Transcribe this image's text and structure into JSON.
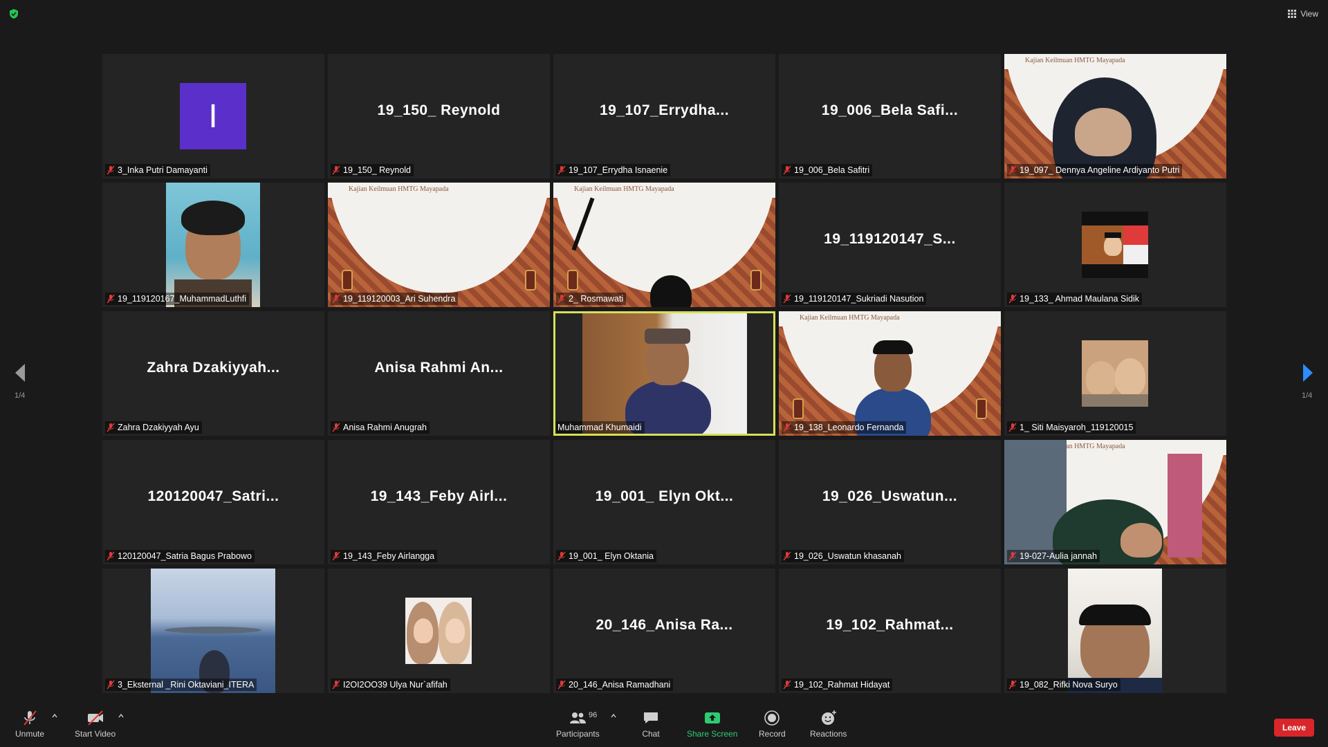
{
  "top": {
    "view_label": "View"
  },
  "tiles": [
    {
      "label": "3_Inka Putri Damayanti",
      "avatar_letter": "I"
    },
    {
      "label": "19_150_ Reynold",
      "big": "19_150_ Reynold"
    },
    {
      "label": "19_107_Errydha Isnaenie",
      "big": "19_107_Errydha..."
    },
    {
      "label": "19_006_Bela Safitri",
      "big": "19_006_Bela Safi..."
    },
    {
      "label": "19_097_ Dennya Angeline Ardiyanto Putri"
    },
    {
      "label": "19_119120167_MuhammadLuthfi"
    },
    {
      "label": "19_119120003_Ari Suhendra"
    },
    {
      "label": "2_ Rosmawati"
    },
    {
      "label": "19_119120147_Sukriadi Nasution",
      "big": "19_119120147_S..."
    },
    {
      "label": "19_133_ Ahmad Maulana Sidik"
    },
    {
      "label": "Zahra Dzakiyyah Ayu",
      "big": "Zahra Dzakiyyah..."
    },
    {
      "label": "Anisa Rahmi Anugrah",
      "big": "Anisa Rahmi An..."
    },
    {
      "label": "Muhammad Khumaidi"
    },
    {
      "label": "19_138_Leonardo Fernanda"
    },
    {
      "label": "1_ Siti Maisyaroh_119120015"
    },
    {
      "label": "120120047_Satria Bagus Prabowo",
      "big": "120120047_Satri..."
    },
    {
      "label": "19_143_Feby Airlangga",
      "big": "19_143_Feby Airl..."
    },
    {
      "label": "19_001_ Elyn Oktania",
      "big": "19_001_ Elyn Okt..."
    },
    {
      "label": "19_026_Uswatun khasanah",
      "big": "19_026_Uswatun..."
    },
    {
      "label": "19-027-Aulia jannah"
    },
    {
      "label": "3_Eksternal _Rini Oktaviani_ITERA"
    },
    {
      "label": "I2OI2OO39 Ulya Nur`afifah"
    },
    {
      "label": "20_146_Anisa Ramadhani",
      "big": "20_146_Anisa Ra..."
    },
    {
      "label": "19_102_Rahmat Hidayat",
      "big": "19_102_Rahmat..."
    },
    {
      "label": "19_082_Rifki Nova Suryo"
    }
  ],
  "banner": {
    "text": "Kajian Keilmuan HMTG Mayapada"
  },
  "pager": {
    "left": "1/4",
    "right": "1/4"
  },
  "toolbar": {
    "unmute": "Unmute",
    "start_video": "Start Video",
    "participants": "Participants",
    "participants_count": "96",
    "chat": "Chat",
    "share_screen": "Share Screen",
    "record": "Record",
    "reactions": "Reactions",
    "leave": "Leave"
  },
  "colors": {
    "active_speaker": "#d6e05a",
    "share_green": "#2ecc71",
    "leave_red": "#d9262a",
    "avatar_purple": "#5b2fc9"
  }
}
